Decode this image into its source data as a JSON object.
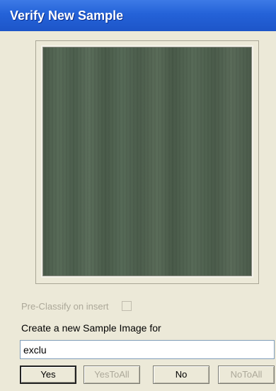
{
  "window": {
    "title": "Verify New Sample"
  },
  "preview": {
    "icon": "sample-image"
  },
  "options": {
    "preclassify_label": "Pre-Classify on insert",
    "preclassify_checked": false
  },
  "prompt": {
    "label": "Create a new Sample Image for"
  },
  "input": {
    "value": "exclu"
  },
  "buttons": {
    "yes": "Yes",
    "yes_to_all": "YesToAll",
    "no": "No",
    "no_to_all": "NoToAll"
  }
}
